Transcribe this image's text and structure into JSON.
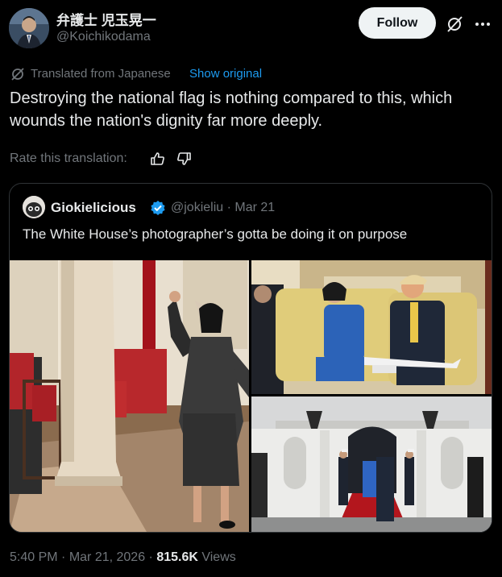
{
  "author": {
    "name": "弁護士 児玉晃一",
    "handle": "@Koichikodama"
  },
  "follow_label": "Follow",
  "translation": {
    "label": "Translated from Japanese",
    "show_original": "Show original"
  },
  "post_text": "Destroying the national flag is nothing compared to this, which wounds the nation's dignity far more deeply.",
  "rate_label": "Rate this translation:",
  "quote": {
    "name": "Giokielicious",
    "handle": "@jokieliu",
    "separator": " · ",
    "date": "Mar 21",
    "text": "The White House’s photographer’s gotta be doing it on purpose"
  },
  "footer": {
    "time": "5:40 PM",
    "separator": " · ",
    "date": "Mar 21, 2026",
    "views_count": "815.6K",
    "views_label": "Views"
  },
  "colors": {
    "background": "#000000",
    "text": "#e7e9ea",
    "muted": "#71767b",
    "link": "#1d9bf0",
    "border": "#2f3336",
    "follow_bg": "#eff3f4"
  },
  "icons": [
    "grok-icon",
    "more-icon",
    "translate-icon",
    "thumbs-up-icon",
    "thumbs-down-icon",
    "verified-badge-icon"
  ]
}
